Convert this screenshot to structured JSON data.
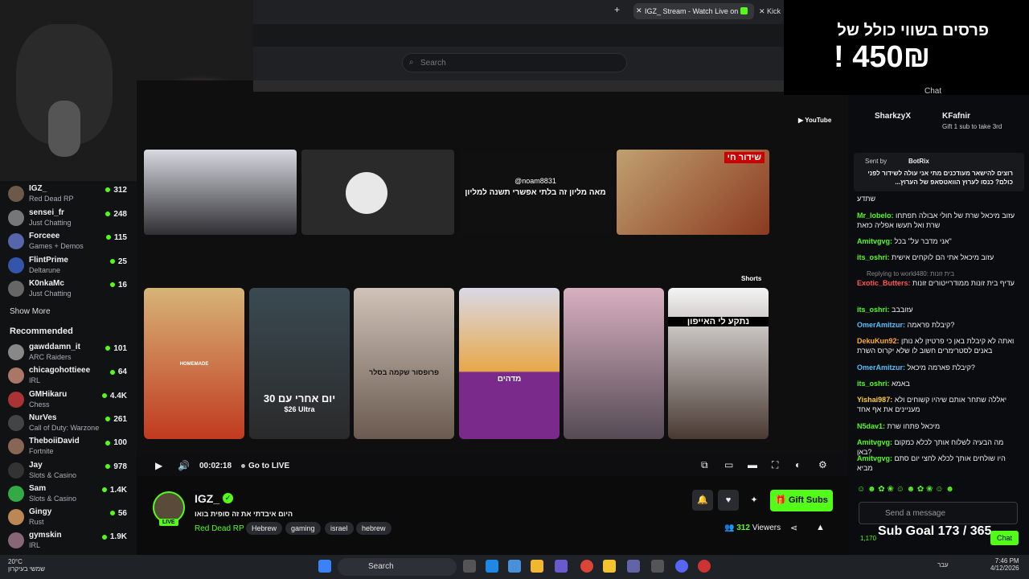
{
  "browser": {
    "tab_active": "IGZ_ Stream - Watch Live on K",
    "tab_other": "Kick",
    "search_placeholder": "Search"
  },
  "overlay": {
    "line1": "פרסים בשווי כולל של",
    "line2": "! 450₪"
  },
  "sidebar": {
    "following": [
      {
        "name": "IGZ_",
        "game": "Red Dead RP",
        "viewers": "312",
        "color": "#6b5a4a"
      },
      {
        "name": "sensei_fr",
        "game": "Just Chatting",
        "viewers": "248",
        "color": "#777"
      },
      {
        "name": "Forceee",
        "game": "Games + Demos",
        "viewers": "115",
        "color": "#5566aa"
      },
      {
        "name": "FlintPrime",
        "game": "Deltarune",
        "viewers": "25",
        "color": "#3355aa"
      },
      {
        "name": "K0nkaMc",
        "game": "Just Chatting",
        "viewers": "16",
        "color": "#666"
      }
    ],
    "show_more": "Show More",
    "recommended_title": "Recommended",
    "recommended": [
      {
        "name": "gawddamn_it",
        "game": "ARC Raiders",
        "viewers": "101",
        "color": "#888"
      },
      {
        "name": "chicagohottieee",
        "game": "IRL",
        "viewers": "64",
        "color": "#aa7766"
      },
      {
        "name": "GMHikaru",
        "game": "Chess",
        "viewers": "4.4K",
        "color": "#aa3333"
      },
      {
        "name": "NurVes",
        "game": "Call of Duty: Warzone",
        "viewers": "261",
        "color": "#444"
      },
      {
        "name": "TheboiiDavid",
        "game": "Fortnite",
        "viewers": "100",
        "color": "#886655"
      },
      {
        "name": "Jay",
        "game": "Slots & Casino",
        "viewers": "978",
        "color": "#333"
      },
      {
        "name": "Sam",
        "game": "Slots & Casino",
        "viewers": "1.4K",
        "color": "#33aa44"
      },
      {
        "name": "Gingy",
        "game": "Rust",
        "viewers": "56",
        "color": "#bb8855"
      },
      {
        "name": "gymskin",
        "game": "IRL",
        "viewers": "1.9K",
        "color": "#886677"
      }
    ]
  },
  "video": {
    "thumb3_text": "מאה מליון זה בלתי אפשרי תשנה למליון",
    "thumb3_user": "@noam8831",
    "thumb4_live": "שידור חי",
    "shorts_label": "Shorts",
    "short2_text": "30 יום אחרי עם",
    "short2_sub": "$26 Ultra",
    "short3_text": "פרופסור שקמה בסלר",
    "short4_text": "מדהים",
    "short6_text": "נתקע לי האייפון",
    "short1_text": "HOMEMADE"
  },
  "player": {
    "time": "00:02:18",
    "go_live": "Go to LIVE"
  },
  "channel": {
    "name": "IGZ_",
    "title": "היום איבדתי את זה סופית בואו",
    "category": "Red Dead RP",
    "tags": [
      "Hebrew",
      "gaming",
      "israel",
      "hebrew"
    ],
    "live_badge": "LIVE",
    "gift_subs": "Gift Subs",
    "viewers_count": "312",
    "viewers_label": "Viewers"
  },
  "chat": {
    "header": "Chat",
    "leader1": "SharkzyX",
    "leader2": "KFafnir",
    "leader2_sub": "Gift 1 sub to take 3rd",
    "pinned_sender_label": "Sent by",
    "pinned_sender": "BotRix",
    "pinned_text": "רוצים להישאר מעודכנים מתי אני עולה לשידור לפני כולם? כנסו לערוץ הוואטסאפ של הערוץ...",
    "messages": [
      {
        "user": "",
        "text": "שתדע",
        "color": "#efeff1"
      },
      {
        "user": "Mr_lobelo:",
        "text": "עזוב מיכאל שרת של חולי אבולה תפתחו שרת ואל תעשו אפליה כזאת",
        "color": "#53fc18"
      },
      {
        "user": "Amitvgvg:",
        "text": "אני מדבר על\" בכל\"",
        "color": "#53fc18"
      },
      {
        "user": "its_oshri:",
        "text": "עזוב מיכאל אתי הם לוקחים אישית",
        "color": "#53fc18"
      },
      {
        "user": "Exotic_Butters:",
        "text": "עדיף בית זונות ממודרייטורים זונות",
        "color": "#ff5555"
      },
      {
        "user": "its_oshri:",
        "text": "עזובבב",
        "color": "#53fc18"
      },
      {
        "user": "OmerAmitzur:",
        "text": "קיבלת פראמה?",
        "color": "#53c0fc"
      },
      {
        "user": "DekuKun92:",
        "text": "ואתה לא קיבלת באן כי פרטיזן לא נותן באנים לסטרימרים חשוב לו שלא יקרוס השרת",
        "color": "#ffaa33"
      },
      {
        "user": "OmerAmitzur:",
        "text": "קיבלת פארמה מיכאל?",
        "color": "#53c0fc"
      },
      {
        "user": "its_oshri:",
        "text": "באמא",
        "color": "#53fc18"
      },
      {
        "user": "Yishai987:",
        "text": "יאללה שתחר אותם שיהיו קשוחים ולא מעניינים את אף אחד",
        "color": "#ffcc33"
      },
      {
        "user": "N5dav1:",
        "text": "מיכאל פתחו שרת",
        "color": "#53fc18"
      },
      {
        "user": "Amitvgvg:",
        "text": "מה הבעיה לשלוח אותך לכלא כמקום באן?",
        "color": "#53fc18"
      },
      {
        "user": "Amitvgvg:",
        "text": "היו שולחים אותך לכלא לחצי יום סתם מביא",
        "color": "#53fc18"
      }
    ],
    "reply_note": "Replying to world480: בית זונות",
    "input_placeholder": "Send a message",
    "sub_goal": "Sub Goal 173 / 365",
    "points": "1,170",
    "chat_button": "Chat"
  },
  "taskbar": {
    "temp": "20°C",
    "weather": "שמשי בעיקרון",
    "search": "Search",
    "lang": "עבר",
    "time": "7:46 PM",
    "date": "4/12/2026"
  }
}
